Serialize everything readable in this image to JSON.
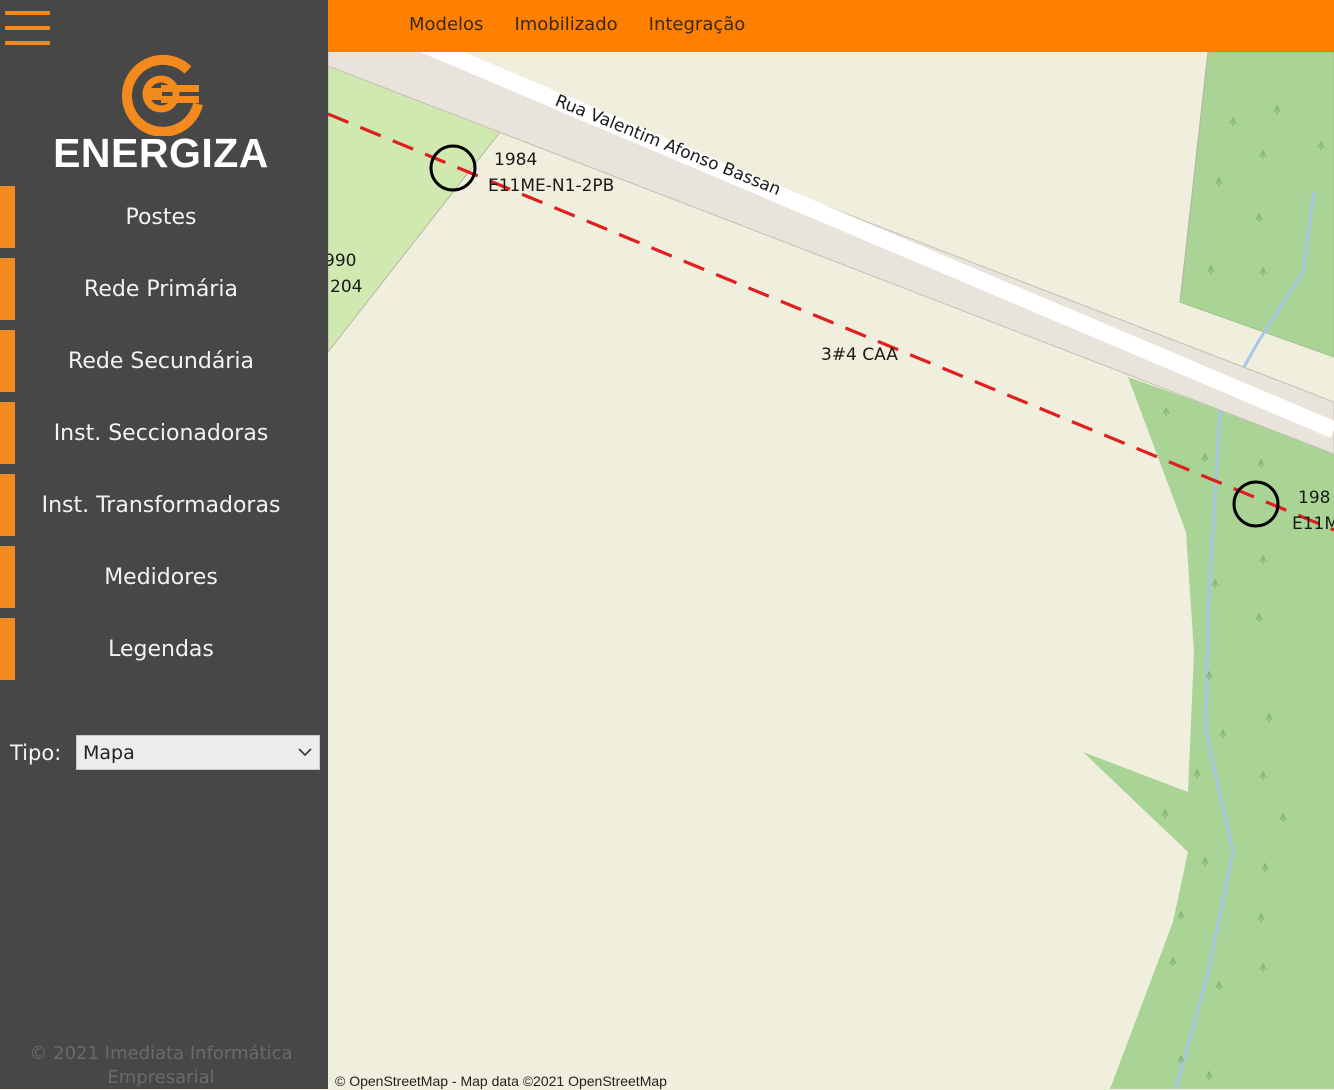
{
  "app": {
    "brand": "ENERGIZA",
    "accent_color": "#f28a1e",
    "topbar_color": "#ff8000",
    "sidebar_color": "#474747"
  },
  "header": {
    "nav": [
      {
        "label": "Modelos"
      },
      {
        "label": "Imobilizado"
      },
      {
        "label": "Integração"
      }
    ]
  },
  "sidebar": {
    "menu_icon": "hamburger-icon",
    "logo_icon": "energy-plug-icon",
    "items": [
      {
        "label": "Postes"
      },
      {
        "label": "Rede Primária"
      },
      {
        "label": "Rede Secundária"
      },
      {
        "label": "Inst. Seccionadoras"
      },
      {
        "label": "Inst. Transformadoras"
      },
      {
        "label": "Medidores"
      },
      {
        "label": "Legendas"
      }
    ],
    "tipo": {
      "label": "Tipo:",
      "value": "Mapa",
      "icon": "chevron-down-icon"
    },
    "copyright": {
      "line1": "© 2021 Imediata Informática",
      "line2": "Empresarial"
    }
  },
  "map": {
    "street_name": "Rua Valentim Afonso Bassan",
    "line_label": "3#4 CAA",
    "poles": [
      {
        "num": "1984",
        "code": "E11ME-N1-2PB"
      },
      {
        "num": "198",
        "code": "E11M"
      }
    ],
    "partial_labels": {
      "top": "990",
      "bottom": "204"
    },
    "attribution": "© OpenStreetMap - Map data ©2021 OpenStreetMap"
  }
}
